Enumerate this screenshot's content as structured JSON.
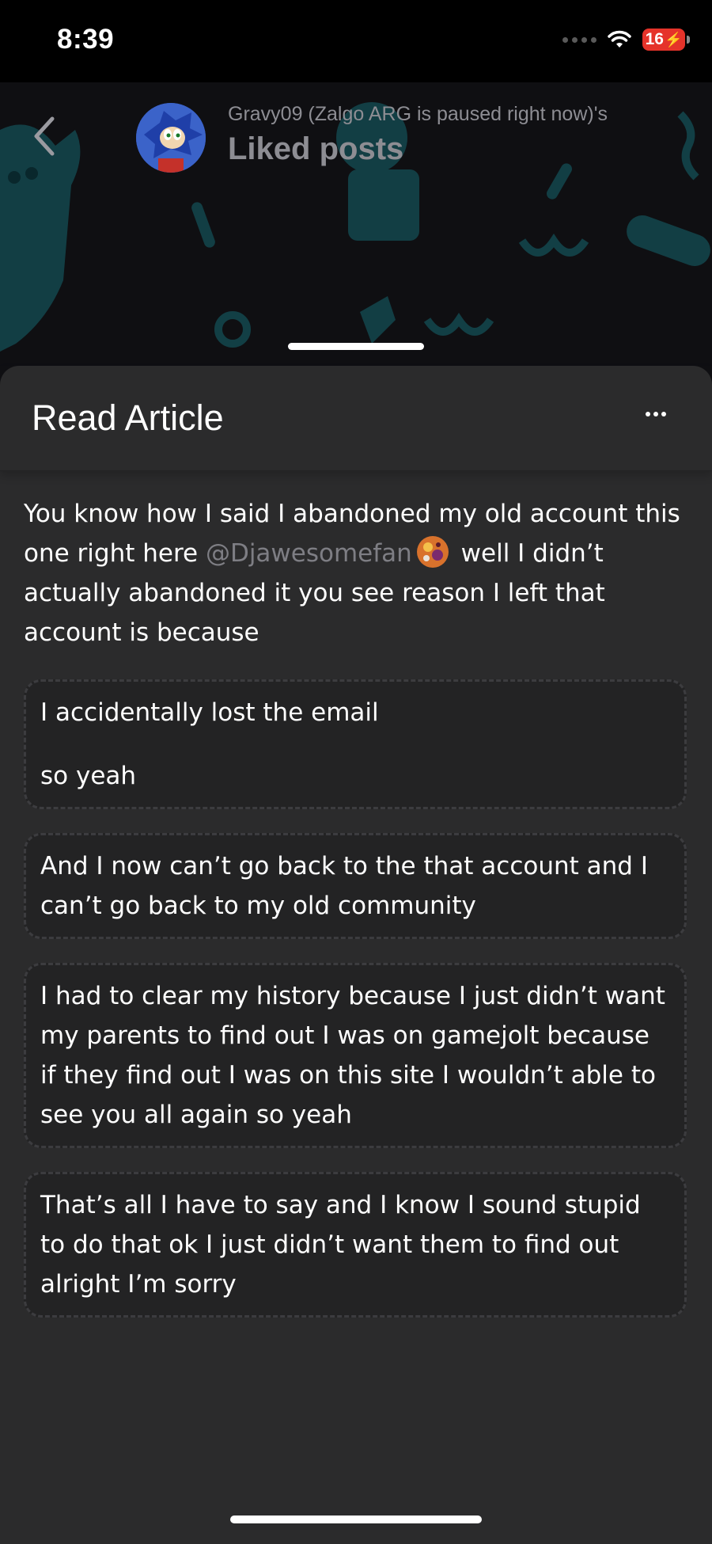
{
  "status_bar": {
    "time": "8:39",
    "battery": "16"
  },
  "header": {
    "subtitle": "Gravy09 (Zalgo ARG is paused right now)'s",
    "title": "Liked posts"
  },
  "sheet": {
    "title": "Read Article"
  },
  "article": {
    "intro_before": "You know how I said I abandoned my old account this one right here ",
    "mention": "@Djawesomefan",
    "intro_after": " well I didn’t actually abandoned it you see reason I left that account is because",
    "quotes": [
      {
        "paragraphs": [
          "I accidentally lost the email",
          "so yeah"
        ]
      },
      {
        "paragraphs": [
          "And I now can’t go back to the that account and I can’t go back to my old community"
        ]
      },
      {
        "paragraphs": [
          "I had to clear my history because I just didn’t want my parents to find out I was on gamejolt because if they find out I was on this site I wouldn’t able to see you all again so yeah"
        ]
      },
      {
        "paragraphs": [
          "That’s all I have to say and I know I sound stupid to do that ok I just didn’t want them to find out alright I’m sorry"
        ]
      }
    ]
  },
  "colors": {
    "sheet_background": "#2b2b2c",
    "quote_background": "#232324",
    "mention": "#7e7e84",
    "header_text": "#8d8d93",
    "header_illustration": "#1f6e78",
    "battery": "#e5332a"
  },
  "icons": {
    "back": "chevron-left-icon",
    "more": "ellipsis-icon",
    "wifi": "wifi-icon",
    "signal": "signal-icon",
    "battery": "battery-charging-icon"
  }
}
